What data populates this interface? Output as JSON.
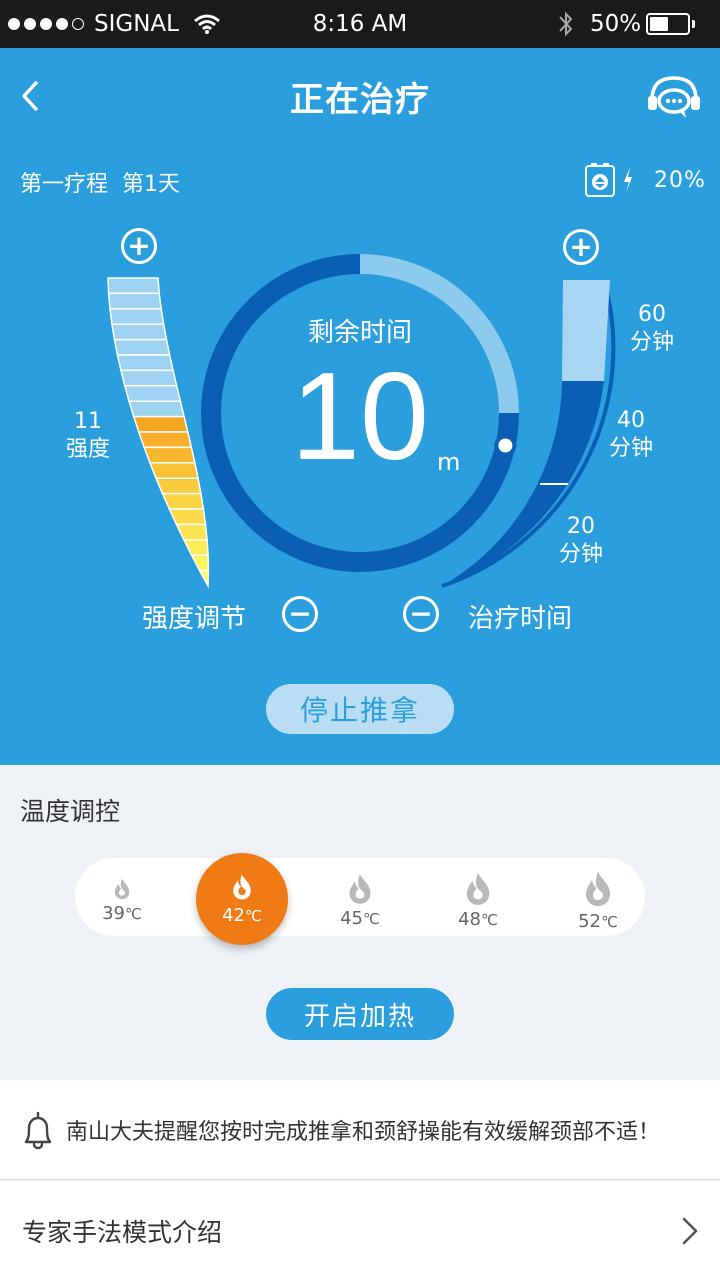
{
  "status_bar": {
    "carrier": "SIGNAL",
    "time": "8:16 AM",
    "battery_percent": "50%",
    "icons": [
      "signal-dots-icon",
      "wifi-icon",
      "bluetooth-icon",
      "battery-icon"
    ]
  },
  "header": {
    "title": "正在治疗",
    "back_icon": "chevron-left-icon",
    "service_icon": "customer-service-icon"
  },
  "treatment": {
    "course": "第一疗程",
    "day": "第1天",
    "device_battery": "20%",
    "remaining_label": "剩余时间",
    "remaining_value": "10",
    "remaining_unit": "m",
    "remaining_fraction": 0.25,
    "intensity_value": "11",
    "intensity_label": "强度",
    "intensity_levels": 20,
    "intensity_active": 11,
    "time_markers": [
      {
        "value": "60",
        "unit": "分钟"
      },
      {
        "value": "40",
        "unit": "分钟"
      },
      {
        "value": "20",
        "unit": "分钟"
      }
    ],
    "selected_duration_minutes": 40,
    "plus_symbol": "+",
    "minus_symbol": "−",
    "intensity_control_label": "强度调节",
    "time_control_label": "治疗时间",
    "stop_button": "停止推拿"
  },
  "temperature": {
    "title": "温度调控",
    "unit": "℃",
    "options": [
      {
        "value": "39",
        "selected": false
      },
      {
        "value": "42",
        "selected": true
      },
      {
        "value": "45",
        "selected": false
      },
      {
        "value": "48",
        "selected": false
      },
      {
        "value": "52",
        "selected": false
      }
    ],
    "heat_button": "开启加热"
  },
  "notice": {
    "text": "南山大夫提醒您按时完成推拿和颈舒操能有效缓解颈部不适！",
    "icon": "bell-icon"
  },
  "expert": {
    "label": "专家手法模式介绍",
    "icon": "chevron-right-icon"
  },
  "colors": {
    "panel_blue": "#2b9fdd",
    "ring_dark": "#0a5fb4",
    "ring_light": "#8ccaee",
    "active_orange": "#f07a14",
    "intensity_orange": "#f5a623",
    "intensity_yellow": "#ffff66"
  }
}
